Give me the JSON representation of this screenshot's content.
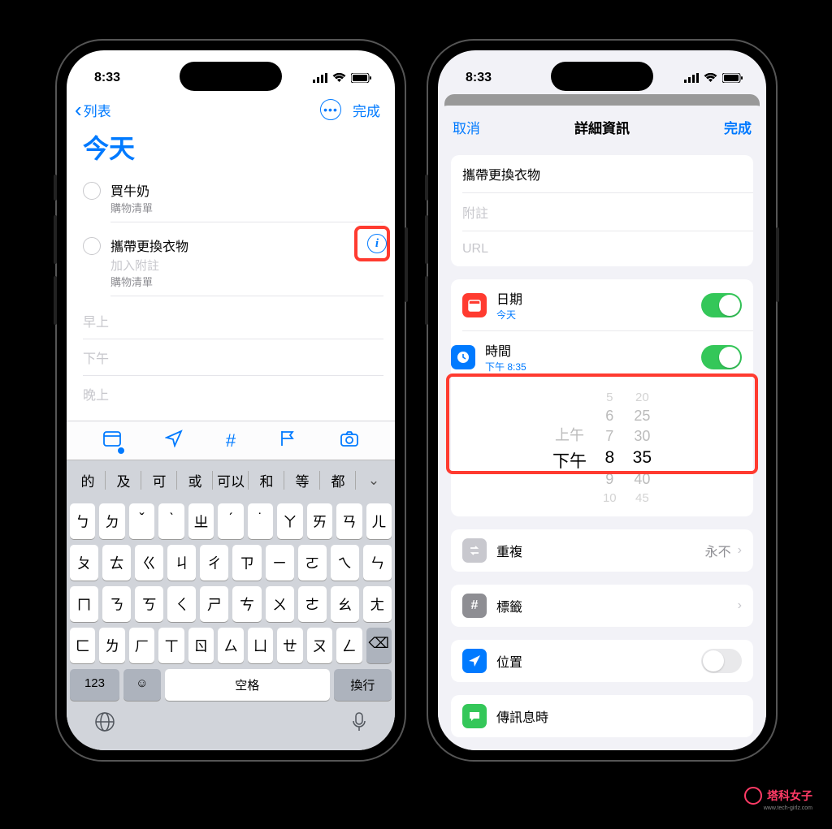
{
  "left": {
    "status_time": "8:33",
    "nav_back": "列表",
    "nav_done": "完成",
    "title": "今天",
    "items": [
      {
        "title": "買牛奶",
        "list": "購物清單"
      },
      {
        "title": "攜帶更換衣物",
        "note": "加入附註",
        "list": "購物清單"
      }
    ],
    "sections": {
      "morning": "早上",
      "afternoon": "下午",
      "evening": "晚上"
    },
    "candidates": [
      "的",
      "及",
      "可",
      "或",
      "可以",
      "和",
      "等",
      "都"
    ],
    "kb": {
      "r1": [
        "ㄅ",
        "ㄉ",
        "ˇ",
        "ˋ",
        "ㄓ",
        "ˊ",
        "˙",
        "ㄚ",
        "ㄞ",
        "ㄢ",
        "ㄦ"
      ],
      "r2": [
        "ㄆ",
        "ㄊ",
        "ㄍ",
        "ㄐ",
        "ㄔ",
        "ㄗ",
        "ㄧ",
        "ㄛ",
        "ㄟ",
        "ㄣ"
      ],
      "r3": [
        "ㄇ",
        "ㄋ",
        "ㄎ",
        "ㄑ",
        "ㄕ",
        "ㄘ",
        "ㄨ",
        "ㄜ",
        "ㄠ",
        "ㄤ"
      ],
      "r4": [
        "ㄈ",
        "ㄌ",
        "ㄏ",
        "ㄒ",
        "ㄖ",
        "ㄙ",
        "ㄩ",
        "ㄝ",
        "ㄡ",
        "ㄥ"
      ],
      "numkey": "123",
      "space": "空格",
      "return": "換行"
    }
  },
  "right": {
    "status_time": "8:33",
    "cancel": "取消",
    "title": "詳細資訊",
    "done": "完成",
    "task_title": "攜帶更換衣物",
    "notes_placeholder": "附註",
    "url_placeholder": "URL",
    "date_label": "日期",
    "date_value": "今天",
    "time_label": "時間",
    "time_value": "下午 8:35",
    "picker": {
      "ampm": {
        "am": "上午",
        "pm": "下午"
      },
      "hours": [
        "5",
        "6",
        "7",
        "8",
        "9",
        "10"
      ],
      "mins": [
        "20",
        "25",
        "30",
        "35",
        "40",
        "45"
      ],
      "sel_h": "8",
      "sel_m": "35",
      "sel_ap": "下午"
    },
    "repeat_label": "重複",
    "repeat_value": "永不",
    "tags_label": "標籤",
    "location_label": "位置",
    "messaging_label": "傳訊息時"
  },
  "watermark": {
    "text": "塔科女子"
  }
}
